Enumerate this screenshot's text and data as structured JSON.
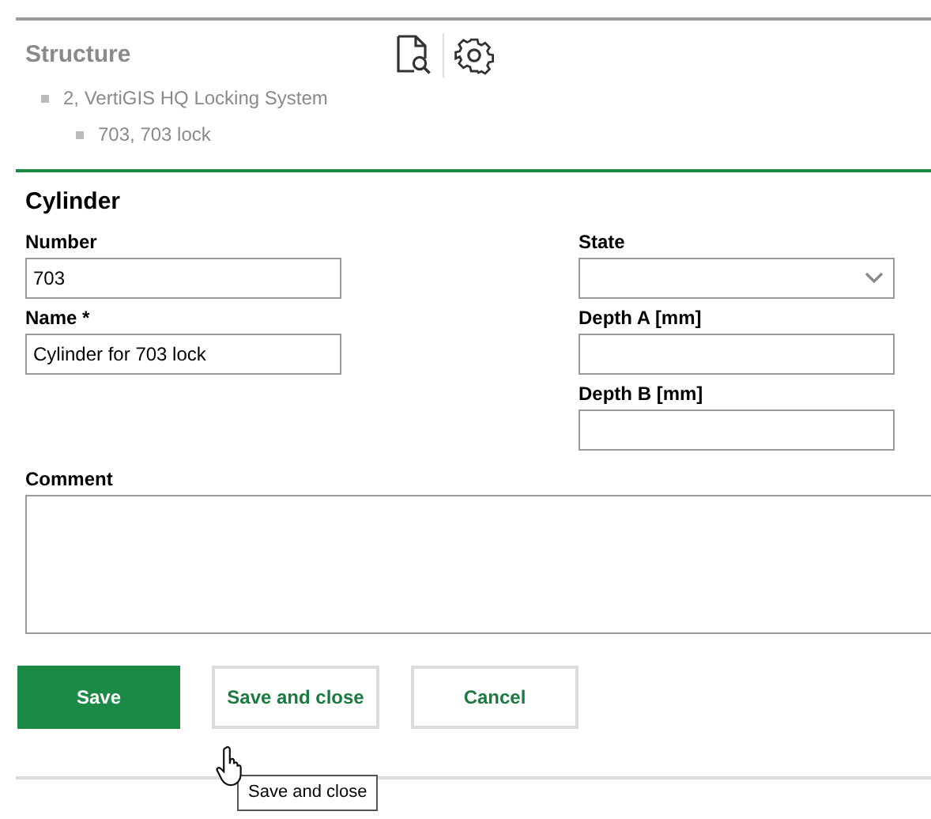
{
  "structure": {
    "title": "Structure",
    "tree": [
      {
        "label": "2, VertiGIS HQ Locking System",
        "children": [
          {
            "label": "703, 703 lock"
          }
        ]
      }
    ]
  },
  "form": {
    "title": "Cylinder",
    "left_fields": [
      {
        "label": "Number",
        "kind": "text",
        "value": "703"
      },
      {
        "label": "Name *",
        "kind": "text",
        "value": "Cylinder for 703 lock"
      }
    ],
    "right_fields": [
      {
        "label": "State",
        "kind": "select"
      },
      {
        "label": "Depth A [mm]",
        "kind": "text"
      },
      {
        "label": "Depth B [mm]",
        "kind": "text"
      }
    ],
    "comment": {
      "label": "Comment"
    }
  },
  "buttons": [
    {
      "label": "Save",
      "kind": "primary"
    },
    {
      "label": "Save and close",
      "kind": "outline"
    },
    {
      "label": "Cancel",
      "kind": "outline"
    }
  ],
  "tooltip": "Save and close"
}
